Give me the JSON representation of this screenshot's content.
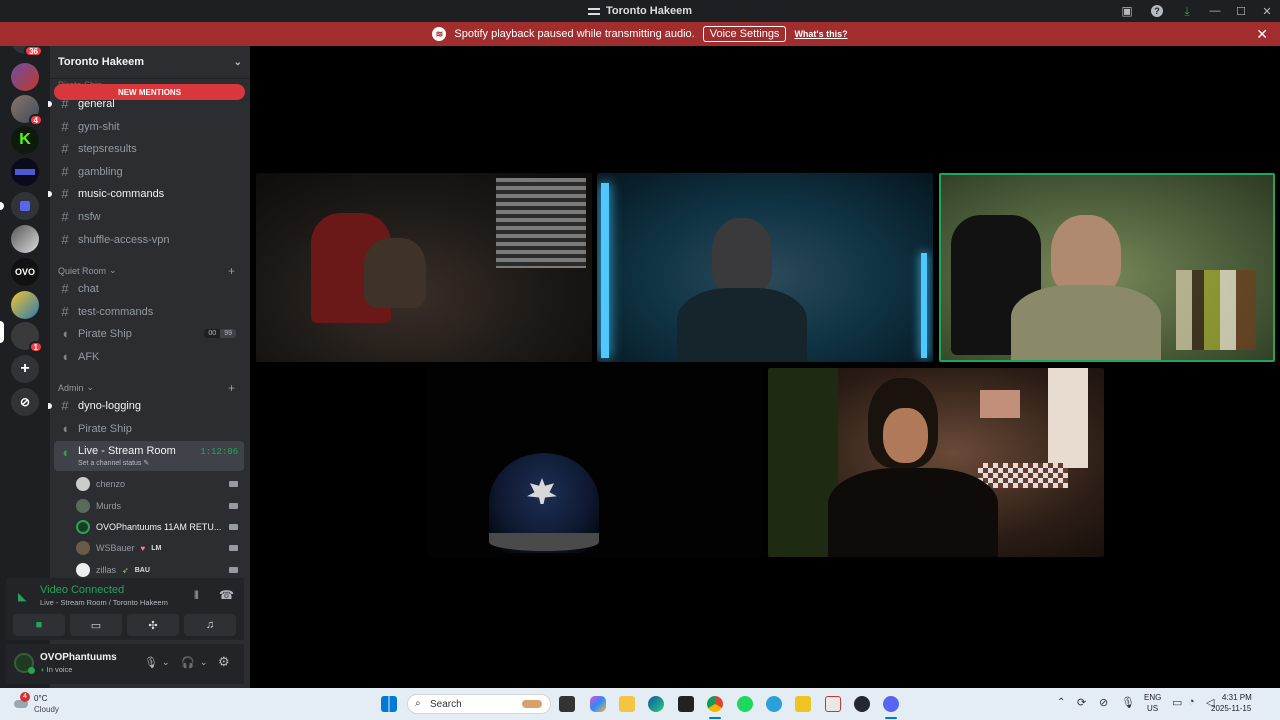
{
  "window": {
    "title": "Toronto Hakeem"
  },
  "banner": {
    "message": "Spotify playback paused while transmitting audio.",
    "button": "Voice Settings",
    "link": "What's this?"
  },
  "rail": {
    "home_badge": "36",
    "server_badge_1": "4",
    "server_badge_2": "1",
    "server_k_label": "K",
    "server_ovo_label": "OVO"
  },
  "sidebar": {
    "guild_name": "Toronto Hakeem",
    "new_mentions": "NEW MENTIONS",
    "hidden_category": "Pirate Ship",
    "channels_top": [
      {
        "name": "general",
        "unread": true
      },
      {
        "name": "gym-shit",
        "unread": false
      },
      {
        "name": "stepsresults",
        "unread": false
      },
      {
        "name": "gambling",
        "unread": false
      },
      {
        "name": "music-commands",
        "unread": true
      },
      {
        "name": "nsfw",
        "unread": false
      },
      {
        "name": "shuffle-access-vpn",
        "unread": false
      }
    ],
    "cat_quiet": "Quiet Room",
    "quiet_channels": [
      {
        "name": "chat"
      },
      {
        "name": "test-commands"
      },
      {
        "name": "Pirate Ship"
      },
      {
        "name": "AFK"
      }
    ],
    "pirate_counter": [
      "00",
      "99"
    ],
    "cat_admin": "Admin",
    "admin_channels": [
      {
        "name": "dyno-logging"
      },
      {
        "name": "Pirate Ship"
      }
    ],
    "live_room": {
      "name": "Live - Stream Room",
      "timer": "1:12:06",
      "status": "Set a channel status"
    },
    "members": [
      {
        "name": "chenzo",
        "tag": ""
      },
      {
        "name": "Murds",
        "tag": ""
      },
      {
        "name": "OVOPhantuums 11AM RETU...",
        "tag": ""
      },
      {
        "name": "WSBauer",
        "tag": "LM"
      },
      {
        "name": "zillas",
        "tag": "BAU"
      }
    ]
  },
  "voice_panel": {
    "status": "Video Connected",
    "location": "Live - Stream Room / Toronto Hakeem"
  },
  "user_panel": {
    "username": "OVOPhantuums",
    "status": "In voice"
  },
  "taskbar": {
    "weather_temp": "0°C",
    "weather_desc": "Cloudy",
    "weather_badge": "4",
    "search_placeholder": "Search",
    "lang_1": "ENG",
    "lang_2": "US",
    "time": "4:31 PM",
    "date": "2025-11-15"
  },
  "colors": {
    "accent_green": "#23a559",
    "banner_red": "#a12d2f",
    "mention_red": "#da373c",
    "sidebar_bg": "#2b2d31"
  }
}
